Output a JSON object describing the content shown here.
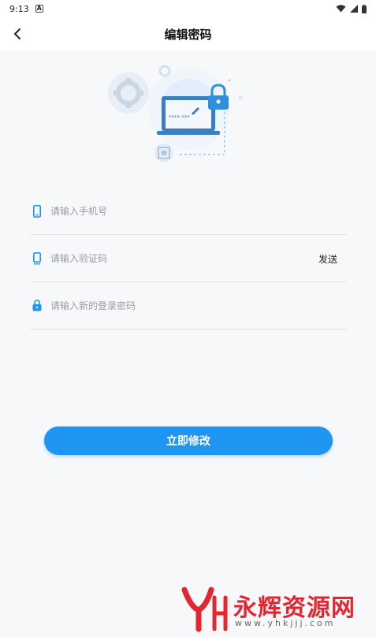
{
  "status_bar": {
    "time": "9:13",
    "notification_icon": "A"
  },
  "header": {
    "title": "编辑密码"
  },
  "form": {
    "phone_placeholder": "请输入手机号",
    "code_placeholder": "请输入验证码",
    "send_label": "发送",
    "password_placeholder": "请输入新的登录密码"
  },
  "submit_label": "立即修改",
  "watermark": {
    "text": "永辉资源网",
    "url": "www.yhkjjj.com"
  },
  "colors": {
    "accent": "#1f95f2",
    "watermark_red": "#e3262f",
    "background": "#f7f8fa"
  }
}
